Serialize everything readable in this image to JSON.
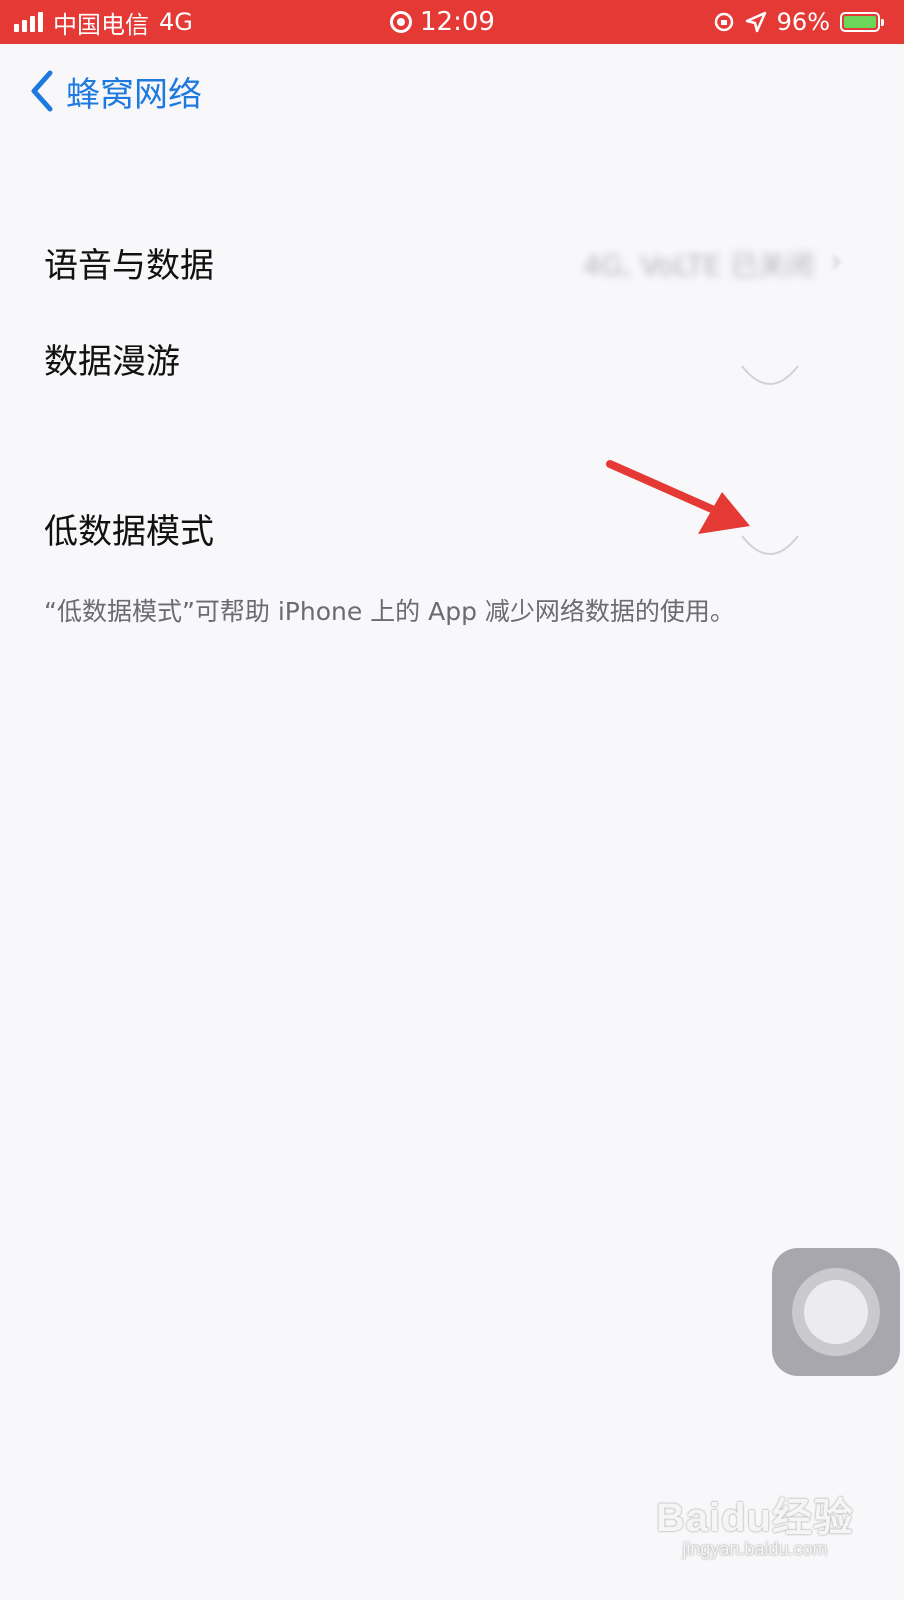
{
  "status_bar": {
    "carrier": "中国电信",
    "network": "4G",
    "time": "12:09",
    "battery": "96%",
    "color": "#e53935"
  },
  "nav": {
    "back_label": "蜂窝网络",
    "accent": "#1f7ae0"
  },
  "settings": {
    "voice_data": {
      "label": "语音与数据",
      "value": "4G, VoLTE 已关闭"
    },
    "roaming": {
      "label": "数据漫游",
      "enabled": false
    },
    "low_data_mode": {
      "label": "低数据模式",
      "enabled": false
    },
    "footer": "“低数据模式”可帮助 iPhone 上的 App 减少网络数据的使用。"
  },
  "watermark": {
    "logo": "Baidu经验",
    "url": "jingyan.baidu.com"
  }
}
